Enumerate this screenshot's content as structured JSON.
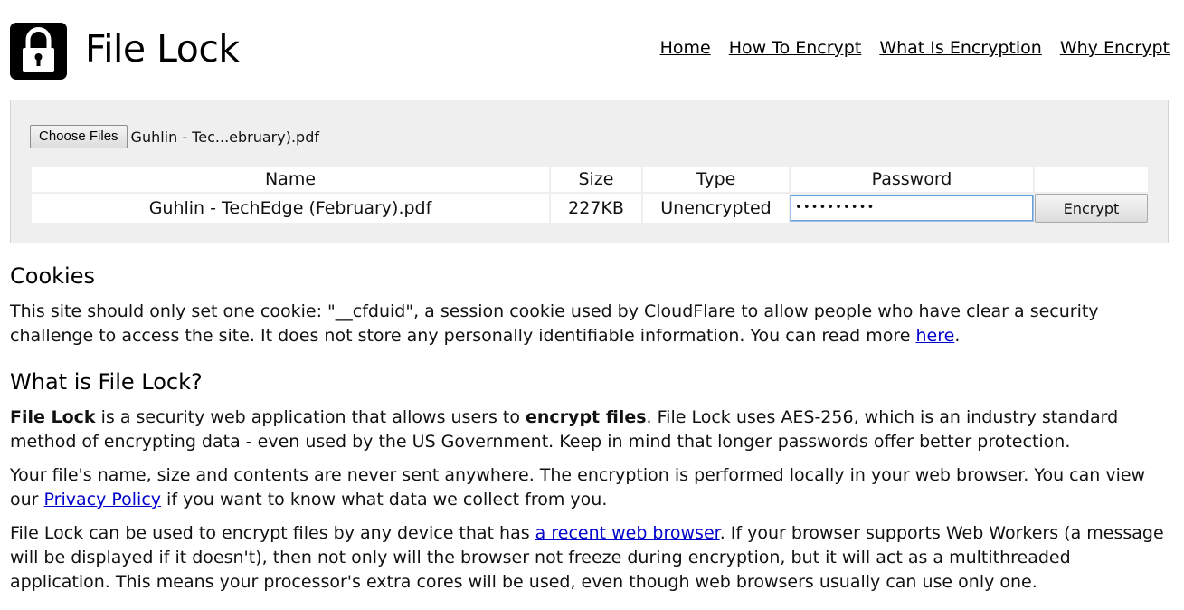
{
  "header": {
    "title": "File Lock",
    "nav": [
      "Home",
      "How To Encrypt",
      "What Is Encryption",
      "Why Encrypt"
    ]
  },
  "tool": {
    "choose_label": "Choose Files",
    "chosen_file": "Guhlin - Tec...ebruary).pdf",
    "columns": [
      "Name",
      "Size",
      "Type",
      "Password",
      ""
    ],
    "row": {
      "name": "Guhlin - TechEdge (February).pdf",
      "size": "227KB",
      "type": "Unencrypted",
      "password_masked": "••••••••••",
      "action": "Encrypt"
    }
  },
  "cookies": {
    "heading": "Cookies",
    "text_before_link": "This site should only set one cookie: \"__cfduid\", a session cookie used by CloudFlare to allow people who have clear a security challenge to access the site. It does not store any personally identifiable information. You can read more ",
    "link": "here",
    "text_after_link": "."
  },
  "about": {
    "heading": "What is File Lock?",
    "p1": {
      "bold1": "File Lock",
      "mid": " is a security web application that allows users to ",
      "bold2": "encrypt files",
      "rest": ". File Lock uses AES-256, which is an industry standard method of encrypting data - even used by the US Government. Keep in mind that longer passwords offer better protection."
    },
    "p2": {
      "before": "Your file's name, size and contents are never sent anywhere. The encryption is performed locally in your web browser. You can view our ",
      "link": "Privacy Policy",
      "after": " if you want to know what data we collect from you."
    },
    "p3": {
      "before": "File Lock can be used to encrypt files by any device that has ",
      "link": "a recent web browser",
      "after": ". If your browser supports Web Workers (a message will be displayed if it doesn't), then not only will the browser not freeze during encryption, but it will act as a multithreaded application. This means your processor's extra cores will be used, even though web browsers usually can use only one."
    }
  },
  "icons": {
    "logo": "padlock-icon"
  },
  "colors": {
    "link": "#0000cc",
    "panel_bg": "#efefef",
    "input_focus": "#6a9fd4"
  }
}
